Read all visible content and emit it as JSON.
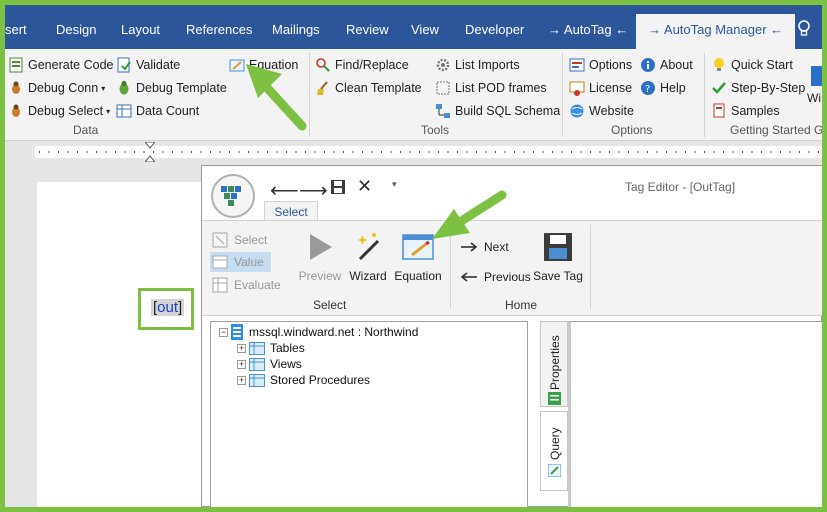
{
  "ribbon_tabs": [
    "sert",
    "Design",
    "Layout",
    "References",
    "Mailings",
    "Review",
    "View",
    "Developer",
    "→ AutoTag ←",
    "→ AutoTag Manager ←"
  ],
  "ribbon": {
    "data_group": {
      "label": "Data",
      "generate_code": "Generate Code",
      "debug_conn": "Debug Conn",
      "debug_select": "Debug Select",
      "validate": "Validate",
      "debug_template": "Debug Template",
      "data_count": "Data Count",
      "equation": "Equation"
    },
    "tools_group": {
      "label": "Tools",
      "find_replace": "Find/Replace",
      "clean_template": "Clean Template",
      "list_imports": "List Imports",
      "list_pod_frames": "List POD frames",
      "build_sql_schema": "Build SQL Schema"
    },
    "options_group": {
      "label": "Options",
      "options": "Options",
      "license": "License",
      "website": "Website",
      "about": "About",
      "help": "Help"
    },
    "getting_started_group": {
      "label": "Getting Started G",
      "quick_start": "Quick Start",
      "step_by_step": "Step-By-Step",
      "samples": "Samples",
      "wi": "Wi"
    }
  },
  "document": {
    "tag_open": "[",
    "tag_text": "out",
    "tag_close": "]"
  },
  "editor": {
    "title": "Tag Editor - [OutTag]",
    "tab": "Select",
    "select": "Select",
    "value": "Value",
    "evaluate": "Evaluate",
    "preview": "Preview",
    "wizard": "Wizard",
    "equation": "Equation",
    "next": "Next",
    "previous": "Previous",
    "save_tag": "Save Tag",
    "select_group_label": "Select",
    "home_group_label": "Home",
    "tree": {
      "root": "mssql.windward.net : Northwind",
      "items": [
        "Tables",
        "Views",
        "Stored Procedures"
      ]
    },
    "side_tabs": {
      "properties": "Properties",
      "query": "Query"
    }
  },
  "colors": {
    "accent_green": "#7cc142",
    "ribbon_blue": "#2b579a"
  }
}
